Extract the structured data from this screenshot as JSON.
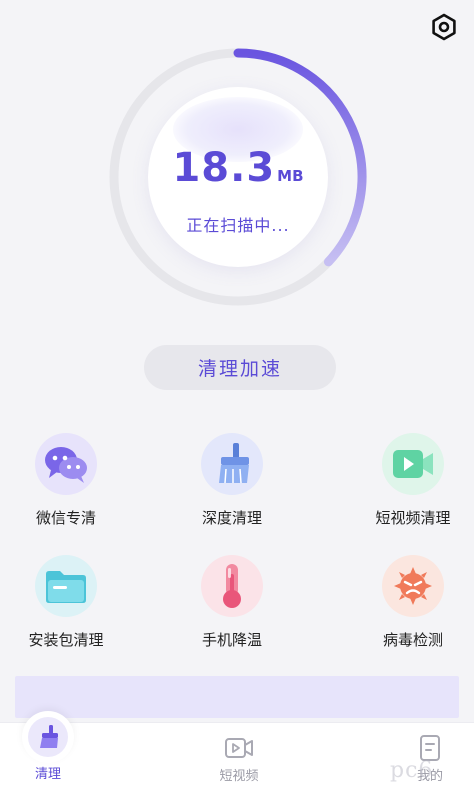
{
  "header": {
    "settings_icon": "settings-hexagon-icon"
  },
  "scan": {
    "size_value": "18.3",
    "size_unit": "MB",
    "status": "正在扫描中...",
    "progress_fraction": 0.37,
    "colors": {
      "accent": "#5b4bd6",
      "track": "#e6e6ea",
      "gradient_end": "#c6bff2"
    }
  },
  "action": {
    "speed_label": "清理加速"
  },
  "tools": [
    {
      "label": "微信专清",
      "icon": "wechat-icon",
      "bg": "#e7e3fb"
    },
    {
      "label": "深度清理",
      "icon": "broom-icon",
      "bg": "#e3e7fb"
    },
    {
      "label": "短视频清理",
      "icon": "video-play-icon",
      "bg": "#dff5ea"
    },
    {
      "label": "安装包清理",
      "icon": "folder-icon",
      "bg": "#dcf2f6"
    },
    {
      "label": "手机降温",
      "icon": "thermometer-icon",
      "bg": "#fbe3e8"
    },
    {
      "label": "病毒检测",
      "icon": "virus-icon",
      "bg": "#fbe6df"
    }
  ],
  "tabbar": {
    "tabs": [
      {
        "label": "清理",
        "icon": "broom-tab-icon",
        "active": true
      },
      {
        "label": "短视频",
        "icon": "video-tab-icon",
        "active": false
      },
      {
        "label": "我的",
        "icon": "profile-tab-icon",
        "active": false
      }
    ]
  },
  "watermark": "pc6"
}
